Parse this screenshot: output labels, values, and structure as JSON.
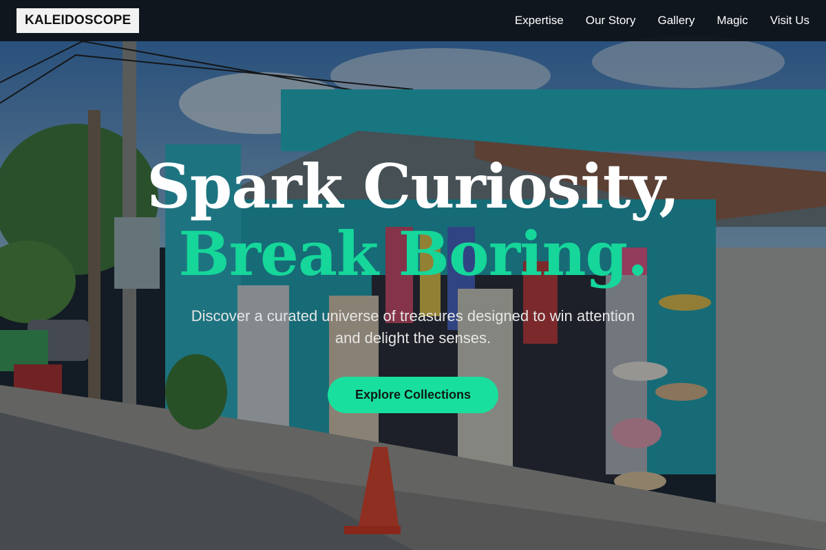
{
  "brand": {
    "logo_text": "KALEIDOSCOPE"
  },
  "nav": {
    "links": [
      {
        "label": "Expertise"
      },
      {
        "label": "Our Story"
      },
      {
        "label": "Gallery"
      },
      {
        "label": "Magic"
      },
      {
        "label": "Visit Us"
      }
    ]
  },
  "hero": {
    "title_line_1": "Spark Curiosity,",
    "title_line_2": "Break Boring.",
    "subtitle": "Discover a curated universe of treasures designed to win attention and delight the senses.",
    "cta_label": "Explore Collections"
  },
  "colors": {
    "accent": "#16d69a",
    "cta_bg": "#19df9e",
    "nav_bg": "#0e1116"
  }
}
